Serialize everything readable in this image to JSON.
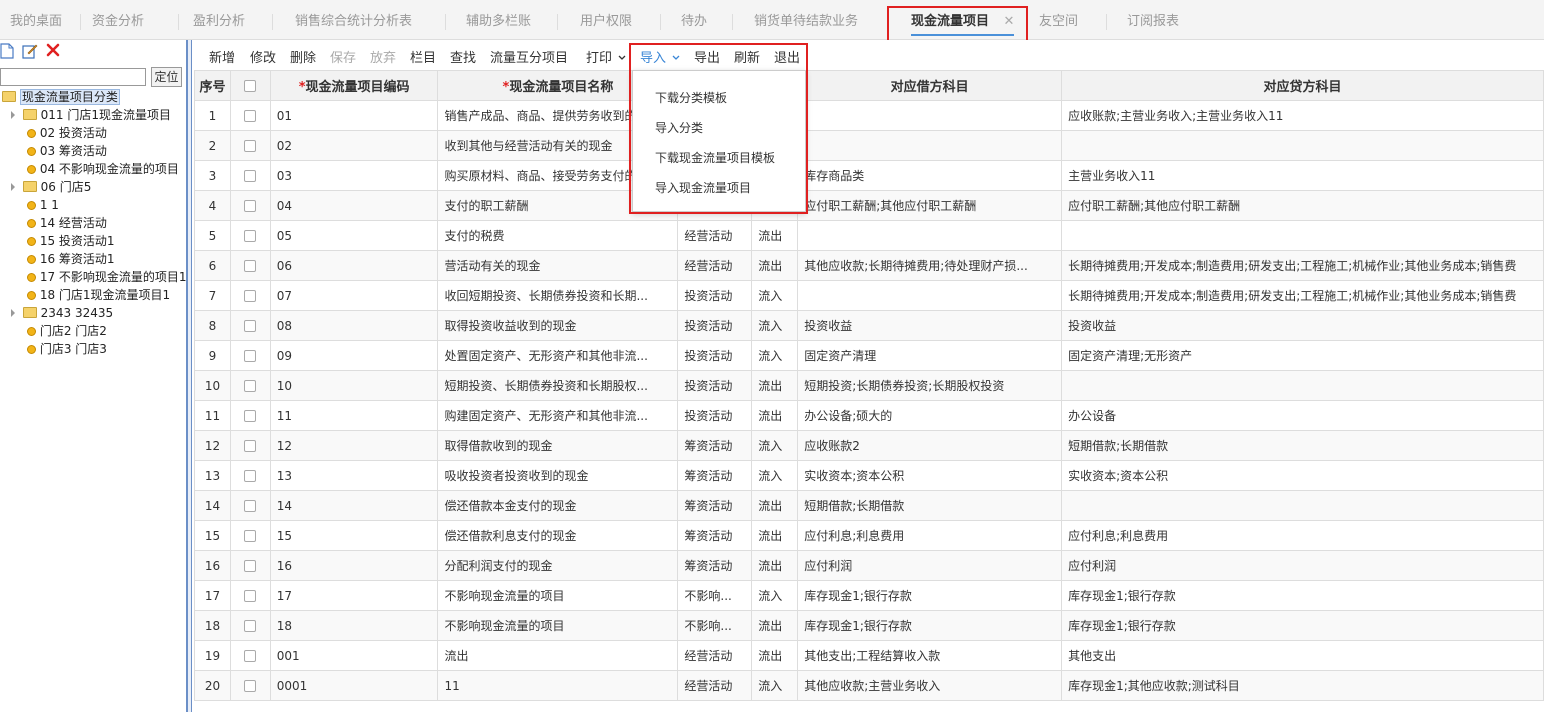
{
  "tabs": [
    {
      "label": "我的桌面"
    },
    {
      "label": "资金分析"
    },
    {
      "label": "盈利分析"
    },
    {
      "label": "销售综合统计分析表"
    },
    {
      "label": "辅助多栏账"
    },
    {
      "label": "用户权限"
    },
    {
      "label": "待办"
    },
    {
      "label": "销货单待结款业务"
    },
    {
      "label": "现金流量项目",
      "active": true,
      "close": "✕"
    },
    {
      "label": "友空间"
    },
    {
      "label": "订阅报表"
    }
  ],
  "left": {
    "search_value": "",
    "locate_label": "定位",
    "tree": [
      {
        "label": "现金流量项目分类"
      },
      {
        "label": "011 门店1现金流量项目"
      },
      {
        "label": "02 投资活动"
      },
      {
        "label": "03 筹资活动"
      },
      {
        "label": "04 不影响现金流量的项目"
      },
      {
        "label": "06 门店5"
      },
      {
        "label": "1 1"
      },
      {
        "label": "14 经营活动"
      },
      {
        "label": "15 投资活动1"
      },
      {
        "label": "16 筹资活动1"
      },
      {
        "label": "17 不影响现金流量的项目1"
      },
      {
        "label": "18 门店1现金流量项目1"
      },
      {
        "label": "2343 32435"
      },
      {
        "label": "门店2 门店2"
      },
      {
        "label": "门店3 门店3"
      }
    ]
  },
  "toolbar": {
    "new": "新增",
    "edit": "修改",
    "delete": "删除",
    "save": "保存",
    "discard": "放弃",
    "columns": "栏目",
    "find": "查找",
    "flow": "流量互分项目",
    "print": "打印",
    "import": "导入",
    "export": "导出",
    "refresh": "刷新",
    "exit": "退出"
  },
  "import_menu": [
    {
      "label": "下载分类模板"
    },
    {
      "label": "导入分类"
    },
    {
      "label": "下载现金流量项目模板"
    },
    {
      "label": "导入现金流量项目"
    }
  ],
  "grid": {
    "required_mark": "*",
    "headers": {
      "seq": "序号",
      "code": "现金流量项目编码",
      "name": "现金流量项目名称",
      "debit": "对应借方科目",
      "credit": "对应贷方科目"
    },
    "rows": [
      {
        "seq": "1",
        "code": "01",
        "name": "销售产成品、商品、提供劳务收到的现金",
        "cat": "",
        "dir": "",
        "debit": "",
        "credit": "应收账款;主营业务收入;主营业务收入11"
      },
      {
        "seq": "2",
        "code": "02",
        "name": "收到其他与经营活动有关的现金",
        "cat": "",
        "dir": "",
        "debit": "",
        "credit": ""
      },
      {
        "seq": "3",
        "code": "03",
        "name": "购买原材料、商品、接受劳务支付的现金",
        "cat": "",
        "dir": "",
        "debit": "库存商品类",
        "credit": "主营业务收入11"
      },
      {
        "seq": "4",
        "code": "04",
        "name": "支付的职工薪酬",
        "cat": "",
        "dir": "",
        "debit": "应付职工薪酬;其他应付职工薪酬",
        "credit": "应付职工薪酬;其他应付职工薪酬"
      },
      {
        "seq": "5",
        "code": "05",
        "name": "支付的税费",
        "cat": "经营活动",
        "dir": "流出",
        "debit": "",
        "credit": ""
      },
      {
        "seq": "6",
        "code": "06",
        "name": "营活动有关的现金",
        "cat": "经营活动",
        "dir": "流出",
        "debit": "其他应收款;长期待摊费用;待处理财产损...",
        "credit": "长期待摊费用;开发成本;制造费用;研发支出;工程施工;机械作业;其他业务成本;销售费"
      },
      {
        "seq": "7",
        "code": "07",
        "name": "收回短期投资、长期债券投资和长期...",
        "cat": "投资活动",
        "dir": "流入",
        "debit": "",
        "credit": "长期待摊费用;开发成本;制造费用;研发支出;工程施工;机械作业;其他业务成本;销售费"
      },
      {
        "seq": "8",
        "code": "08",
        "name": "取得投资收益收到的现金",
        "cat": "投资活动",
        "dir": "流入",
        "debit": "投资收益",
        "credit": "投资收益"
      },
      {
        "seq": "9",
        "code": "09",
        "name": "处置固定资产、无形资产和其他非流...",
        "cat": "投资活动",
        "dir": "流入",
        "debit": "固定资产清理",
        "credit": "固定资产清理;无形资产"
      },
      {
        "seq": "10",
        "code": "10",
        "name": "短期投资、长期债券投资和长期股权...",
        "cat": "投资活动",
        "dir": "流出",
        "debit": "短期投资;长期债券投资;长期股权投资",
        "credit": ""
      },
      {
        "seq": "11",
        "code": "11",
        "name": "购建固定资产、无形资产和其他非流...",
        "cat": "投资活动",
        "dir": "流出",
        "debit": "办公设备;硕大的",
        "credit": "办公设备"
      },
      {
        "seq": "12",
        "code": "12",
        "name": "取得借款收到的现金",
        "cat": "筹资活动",
        "dir": "流入",
        "debit": "应收账款2",
        "credit": "短期借款;长期借款"
      },
      {
        "seq": "13",
        "code": "13",
        "name": "吸收投资者投资收到的现金",
        "cat": "筹资活动",
        "dir": "流入",
        "debit": "实收资本;资本公积",
        "credit": "实收资本;资本公积"
      },
      {
        "seq": "14",
        "code": "14",
        "name": "偿还借款本金支付的现金",
        "cat": "筹资活动",
        "dir": "流出",
        "debit": "短期借款;长期借款",
        "credit": ""
      },
      {
        "seq": "15",
        "code": "15",
        "name": "偿还借款利息支付的现金",
        "cat": "筹资活动",
        "dir": "流出",
        "debit": "应付利息;利息费用",
        "credit": "应付利息;利息费用"
      },
      {
        "seq": "16",
        "code": "16",
        "name": "分配利润支付的现金",
        "cat": "筹资活动",
        "dir": "流出",
        "debit": "应付利润",
        "credit": "应付利润"
      },
      {
        "seq": "17",
        "code": "17",
        "name": "不影响现金流量的项目",
        "cat": "不影响...",
        "dir": "流入",
        "debit": "库存现金1;银行存款",
        "credit": "库存现金1;银行存款"
      },
      {
        "seq": "18",
        "code": "18",
        "name": "不影响现金流量的项目",
        "cat": "不影响...",
        "dir": "流出",
        "debit": "库存现金1;银行存款",
        "credit": "库存现金1;银行存款"
      },
      {
        "seq": "19",
        "code": "001",
        "name": "流出",
        "cat": "经营活动",
        "dir": "流出",
        "debit": "其他支出;工程结算收入款",
        "credit": "其他支出"
      },
      {
        "seq": "20",
        "code": "0001",
        "name": "11",
        "cat": "经营活动",
        "dir": "流入",
        "debit": "其他应收款;主营业务收入",
        "credit": "库存现金1;其他应收款;测试科目"
      }
    ]
  }
}
